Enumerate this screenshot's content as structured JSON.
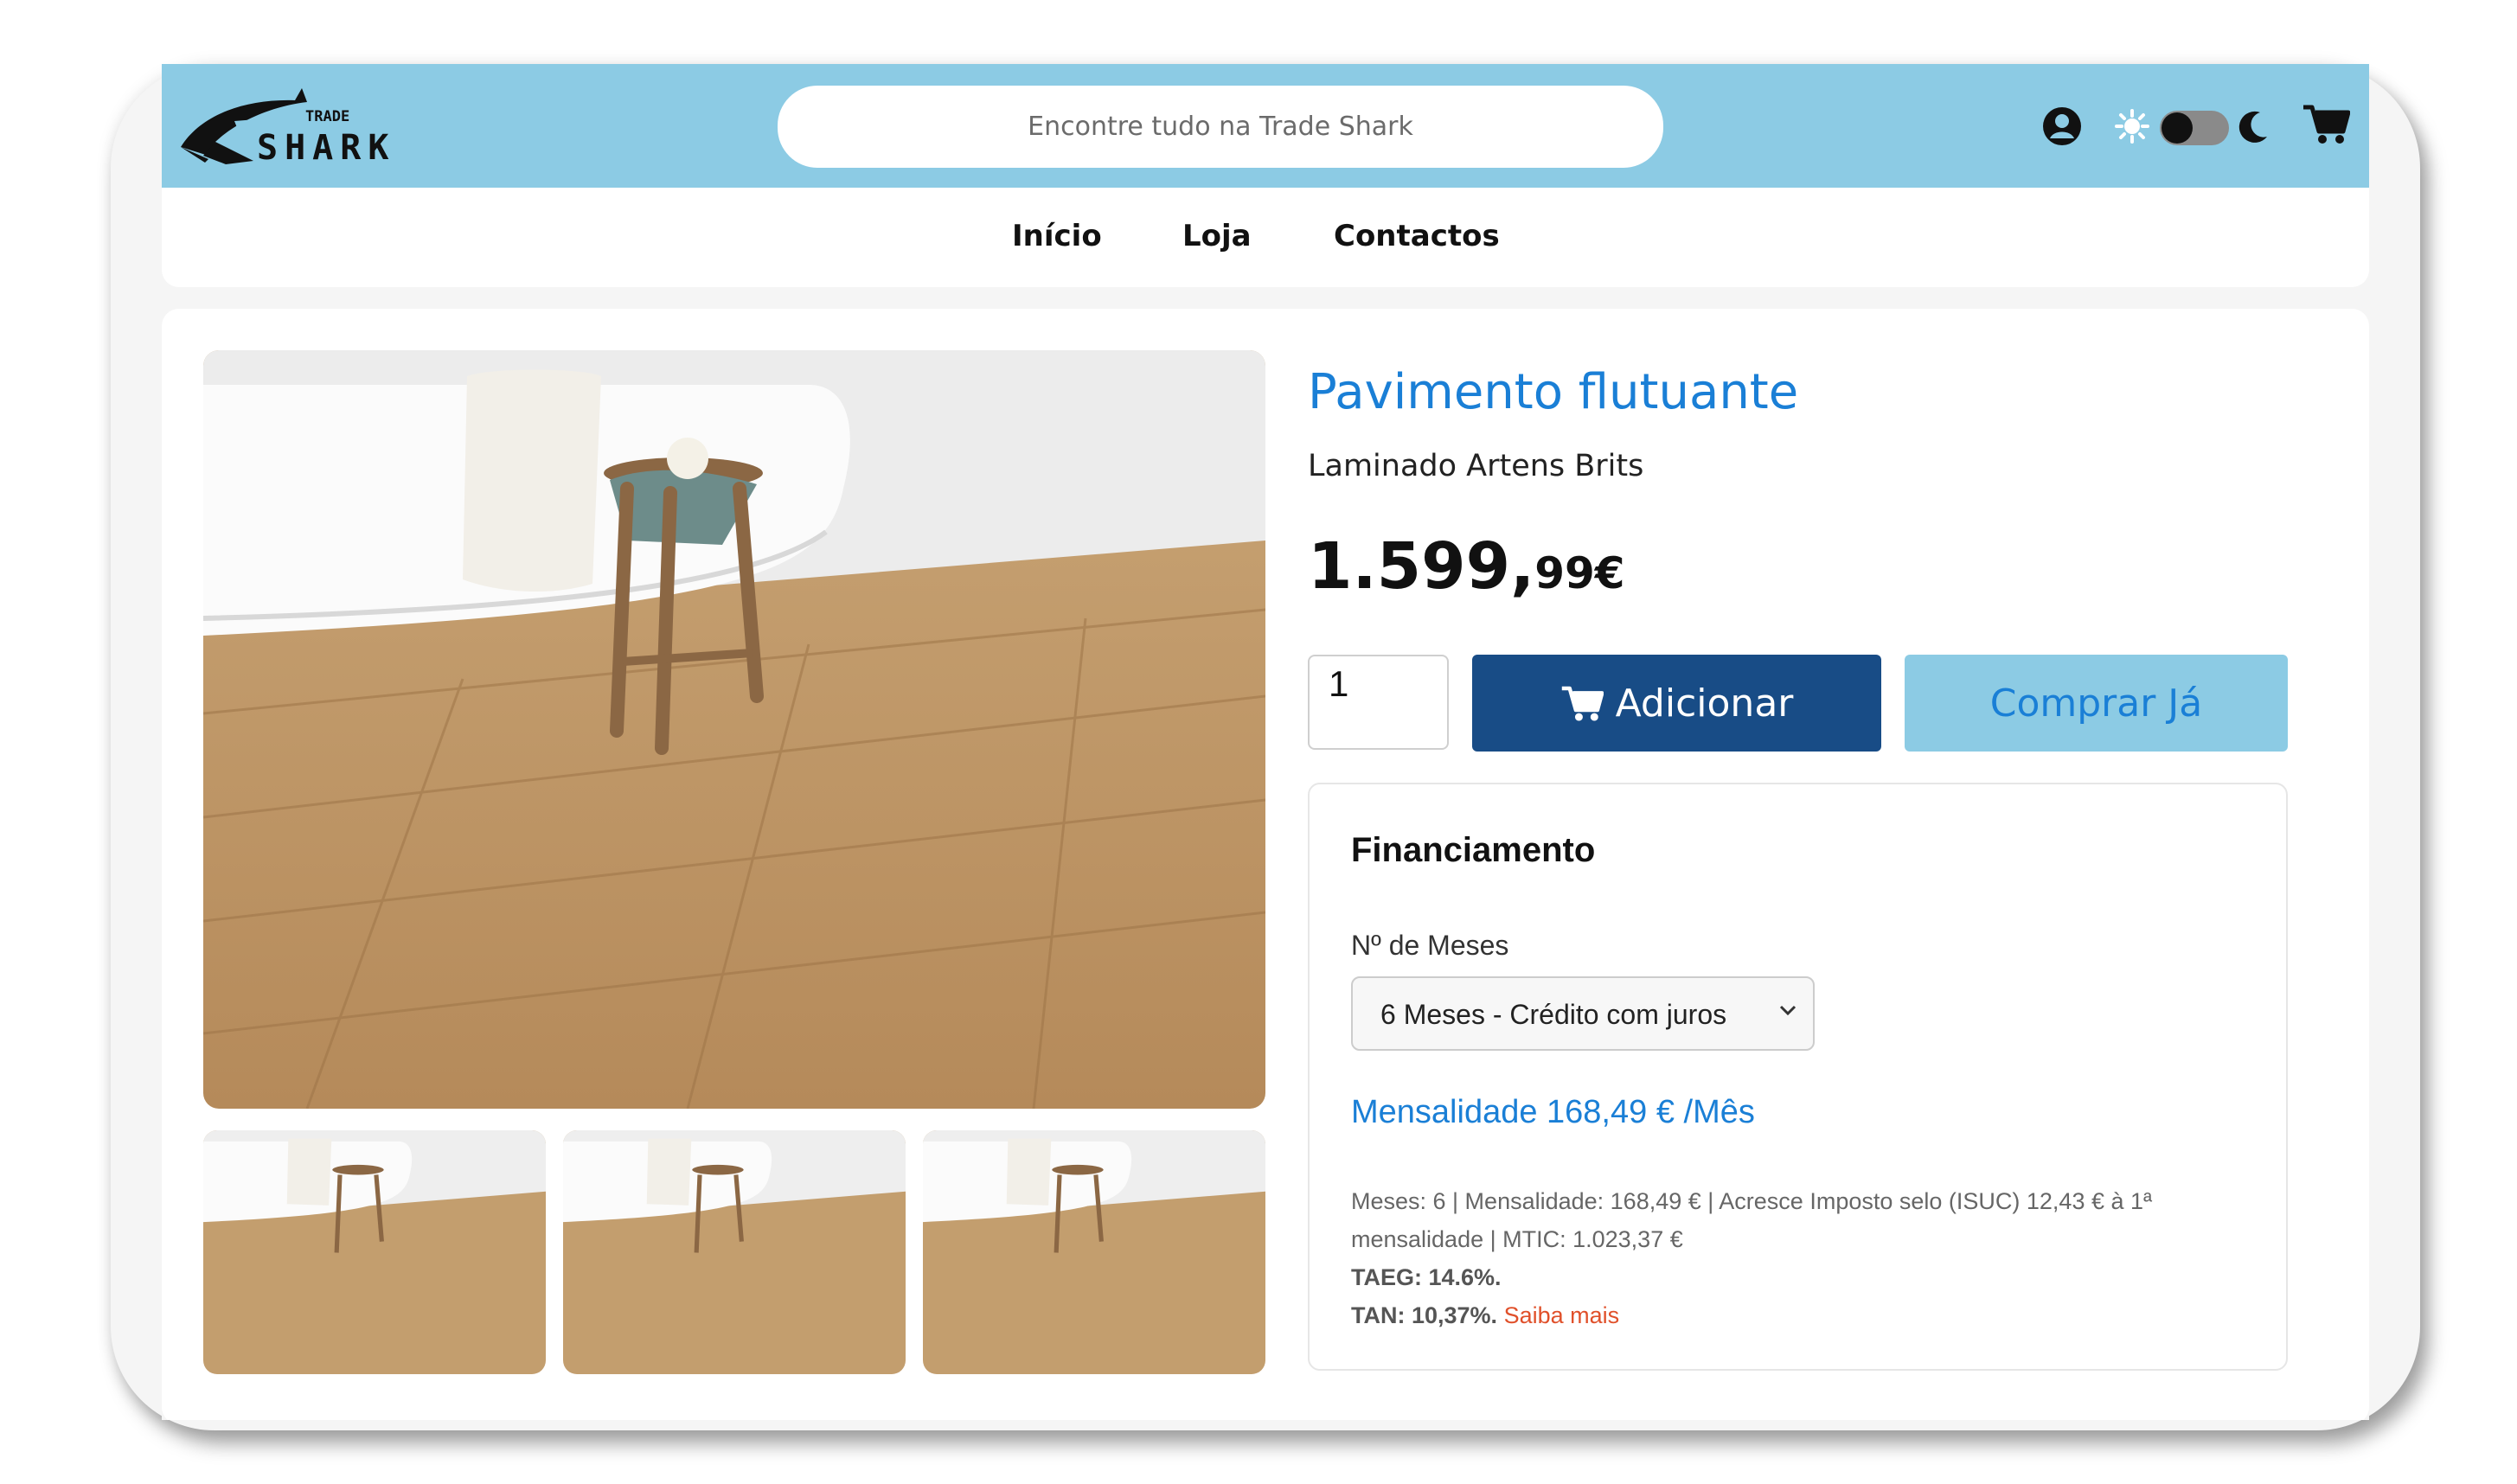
{
  "brand": {
    "logo_text_top": "TRADE",
    "logo_text_bottom": "SHARK"
  },
  "search": {
    "placeholder": "Encontre tudo na Trade Shark"
  },
  "header_icons": [
    "user-icon",
    "sun-icon",
    "theme-toggle",
    "moon-icon",
    "cart-icon"
  ],
  "nav": {
    "items": [
      {
        "label": "Início"
      },
      {
        "label": "Loja"
      },
      {
        "label": "Contactos"
      }
    ]
  },
  "product": {
    "title": "Pavimento flutuante",
    "subtitle": "Laminado Artens Brits",
    "price_int": "1.599,",
    "price_dec": "99€",
    "quantity": "1",
    "add_label": "Adicionar",
    "buy_label": "Comprar Já"
  },
  "financing": {
    "title": "Financiamento",
    "months_label": "Nº de Meses",
    "selected_option": "6 Meses - Crédito com juros",
    "monthly": "Mensalidade 168,49 € /Mês",
    "details_line": "Meses: 6 | Mensalidade: 168,49 € | Acresce Imposto selo (ISUC) 12,43 € à 1ª mensalidade | MTIC: 1.023,37 €",
    "taeg": "TAEG: 14.6%.",
    "tan": "TAN: 10,37%.",
    "more_link": "Saiba mais"
  },
  "colors": {
    "header_bg": "#8ccbe4",
    "primary_button": "#184c86",
    "accent_text": "#1a7fd6",
    "link_red": "#e0502a"
  }
}
